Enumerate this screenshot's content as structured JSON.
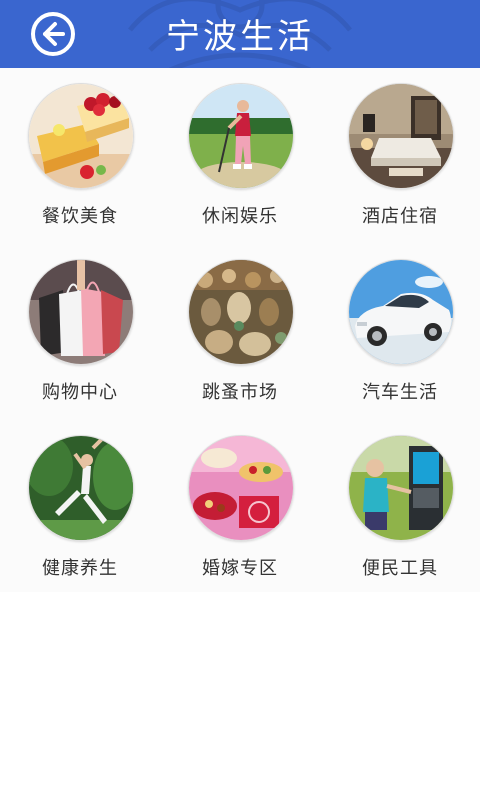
{
  "header": {
    "title": "宁波生活",
    "back_icon": "arrow-left-circle-icon",
    "bg_color": "#3a66cf"
  },
  "categories": [
    {
      "label": "餐饮美食",
      "icon": "cake-food-image"
    },
    {
      "label": "休闲娱乐",
      "icon": "golf-player-image"
    },
    {
      "label": "酒店住宿",
      "icon": "hotel-room-image"
    },
    {
      "label": "购物中心",
      "icon": "shopping-bags-image"
    },
    {
      "label": "跳蚤市场",
      "icon": "market-figurines-image"
    },
    {
      "label": "汽车生活",
      "icon": "white-car-image"
    },
    {
      "label": "健康养生",
      "icon": "yoga-pose-image"
    },
    {
      "label": "婚嫁专区",
      "icon": "wedding-food-image"
    },
    {
      "label": "便民工具",
      "icon": "kiosk-child-image"
    }
  ]
}
